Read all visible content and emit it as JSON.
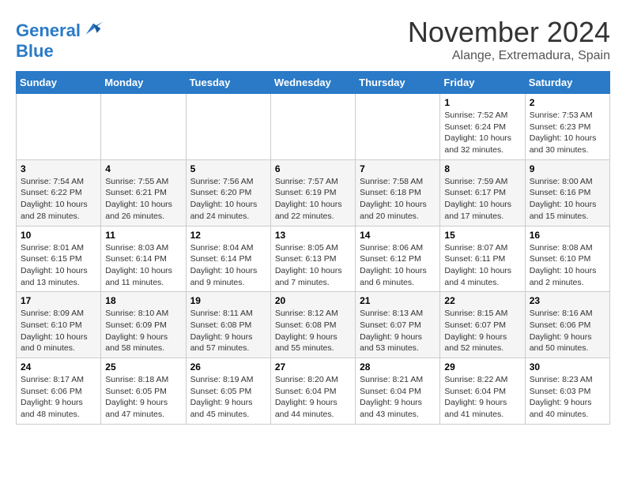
{
  "logo": {
    "line1": "General",
    "line2": "Blue"
  },
  "title": "November 2024",
  "location": "Alange, Extremadura, Spain",
  "weekdays": [
    "Sunday",
    "Monday",
    "Tuesday",
    "Wednesday",
    "Thursday",
    "Friday",
    "Saturday"
  ],
  "weeks": [
    [
      {
        "day": "",
        "info": ""
      },
      {
        "day": "",
        "info": ""
      },
      {
        "day": "",
        "info": ""
      },
      {
        "day": "",
        "info": ""
      },
      {
        "day": "",
        "info": ""
      },
      {
        "day": "1",
        "info": "Sunrise: 7:52 AM\nSunset: 6:24 PM\nDaylight: 10 hours and 32 minutes."
      },
      {
        "day": "2",
        "info": "Sunrise: 7:53 AM\nSunset: 6:23 PM\nDaylight: 10 hours and 30 minutes."
      }
    ],
    [
      {
        "day": "3",
        "info": "Sunrise: 7:54 AM\nSunset: 6:22 PM\nDaylight: 10 hours and 28 minutes."
      },
      {
        "day": "4",
        "info": "Sunrise: 7:55 AM\nSunset: 6:21 PM\nDaylight: 10 hours and 26 minutes."
      },
      {
        "day": "5",
        "info": "Sunrise: 7:56 AM\nSunset: 6:20 PM\nDaylight: 10 hours and 24 minutes."
      },
      {
        "day": "6",
        "info": "Sunrise: 7:57 AM\nSunset: 6:19 PM\nDaylight: 10 hours and 22 minutes."
      },
      {
        "day": "7",
        "info": "Sunrise: 7:58 AM\nSunset: 6:18 PM\nDaylight: 10 hours and 20 minutes."
      },
      {
        "day": "8",
        "info": "Sunrise: 7:59 AM\nSunset: 6:17 PM\nDaylight: 10 hours and 17 minutes."
      },
      {
        "day": "9",
        "info": "Sunrise: 8:00 AM\nSunset: 6:16 PM\nDaylight: 10 hours and 15 minutes."
      }
    ],
    [
      {
        "day": "10",
        "info": "Sunrise: 8:01 AM\nSunset: 6:15 PM\nDaylight: 10 hours and 13 minutes."
      },
      {
        "day": "11",
        "info": "Sunrise: 8:03 AM\nSunset: 6:14 PM\nDaylight: 10 hours and 11 minutes."
      },
      {
        "day": "12",
        "info": "Sunrise: 8:04 AM\nSunset: 6:14 PM\nDaylight: 10 hours and 9 minutes."
      },
      {
        "day": "13",
        "info": "Sunrise: 8:05 AM\nSunset: 6:13 PM\nDaylight: 10 hours and 7 minutes."
      },
      {
        "day": "14",
        "info": "Sunrise: 8:06 AM\nSunset: 6:12 PM\nDaylight: 10 hours and 6 minutes."
      },
      {
        "day": "15",
        "info": "Sunrise: 8:07 AM\nSunset: 6:11 PM\nDaylight: 10 hours and 4 minutes."
      },
      {
        "day": "16",
        "info": "Sunrise: 8:08 AM\nSunset: 6:10 PM\nDaylight: 10 hours and 2 minutes."
      }
    ],
    [
      {
        "day": "17",
        "info": "Sunrise: 8:09 AM\nSunset: 6:10 PM\nDaylight: 10 hours and 0 minutes."
      },
      {
        "day": "18",
        "info": "Sunrise: 8:10 AM\nSunset: 6:09 PM\nDaylight: 9 hours and 58 minutes."
      },
      {
        "day": "19",
        "info": "Sunrise: 8:11 AM\nSunset: 6:08 PM\nDaylight: 9 hours and 57 minutes."
      },
      {
        "day": "20",
        "info": "Sunrise: 8:12 AM\nSunset: 6:08 PM\nDaylight: 9 hours and 55 minutes."
      },
      {
        "day": "21",
        "info": "Sunrise: 8:13 AM\nSunset: 6:07 PM\nDaylight: 9 hours and 53 minutes."
      },
      {
        "day": "22",
        "info": "Sunrise: 8:15 AM\nSunset: 6:07 PM\nDaylight: 9 hours and 52 minutes."
      },
      {
        "day": "23",
        "info": "Sunrise: 8:16 AM\nSunset: 6:06 PM\nDaylight: 9 hours and 50 minutes."
      }
    ],
    [
      {
        "day": "24",
        "info": "Sunrise: 8:17 AM\nSunset: 6:06 PM\nDaylight: 9 hours and 48 minutes."
      },
      {
        "day": "25",
        "info": "Sunrise: 8:18 AM\nSunset: 6:05 PM\nDaylight: 9 hours and 47 minutes."
      },
      {
        "day": "26",
        "info": "Sunrise: 8:19 AM\nSunset: 6:05 PM\nDaylight: 9 hours and 45 minutes."
      },
      {
        "day": "27",
        "info": "Sunrise: 8:20 AM\nSunset: 6:04 PM\nDaylight: 9 hours and 44 minutes."
      },
      {
        "day": "28",
        "info": "Sunrise: 8:21 AM\nSunset: 6:04 PM\nDaylight: 9 hours and 43 minutes."
      },
      {
        "day": "29",
        "info": "Sunrise: 8:22 AM\nSunset: 6:04 PM\nDaylight: 9 hours and 41 minutes."
      },
      {
        "day": "30",
        "info": "Sunrise: 8:23 AM\nSunset: 6:03 PM\nDaylight: 9 hours and 40 minutes."
      }
    ]
  ]
}
